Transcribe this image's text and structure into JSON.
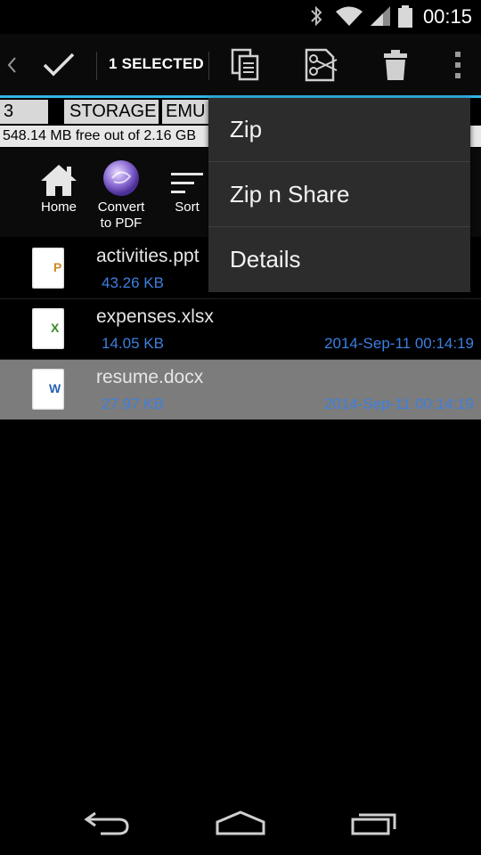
{
  "status_bar": {
    "time": "00:15",
    "icons": [
      "bluetooth-icon",
      "wifi-icon",
      "signal-icon",
      "battery-icon"
    ]
  },
  "action_bar": {
    "selected_label": "1 SELECTED",
    "actions": [
      "done-check-icon",
      "copy-icon",
      "cut-icon",
      "delete-icon",
      "overflow-icon"
    ]
  },
  "path_bar": {
    "segments": [
      "3",
      "STORAGE",
      "EMU"
    ],
    "free_space": "548.14 MB free out of 2.16 GB"
  },
  "toolbar": {
    "home_label": "Home",
    "convert_label_line1": "Convert",
    "convert_label_line2": "to PDF",
    "sort_label": "Sort"
  },
  "files": [
    {
      "name": "activities.ppt",
      "size": "43.26 KB",
      "date": "",
      "type_letter": "P",
      "type_color": "#d0892a"
    },
    {
      "name": "expenses.xlsx",
      "size": "14.05 KB",
      "date": "2014-Sep-11 00:14:19",
      "type_letter": "X",
      "type_color": "#3a8a2a"
    },
    {
      "name": "resume.docx",
      "size": "27.97 KB",
      "date": "2014-Sep-11 00:14:19",
      "type_letter": "W",
      "type_color": "#2a62b8"
    }
  ],
  "menu": {
    "items": [
      "Zip",
      "Zip n Share",
      "Details"
    ]
  },
  "colors": {
    "accent": "#33b5e5",
    "link_text": "#3d7fe0",
    "selected_row": "#7c7c7c",
    "menu_bg": "#2c2c2c"
  }
}
